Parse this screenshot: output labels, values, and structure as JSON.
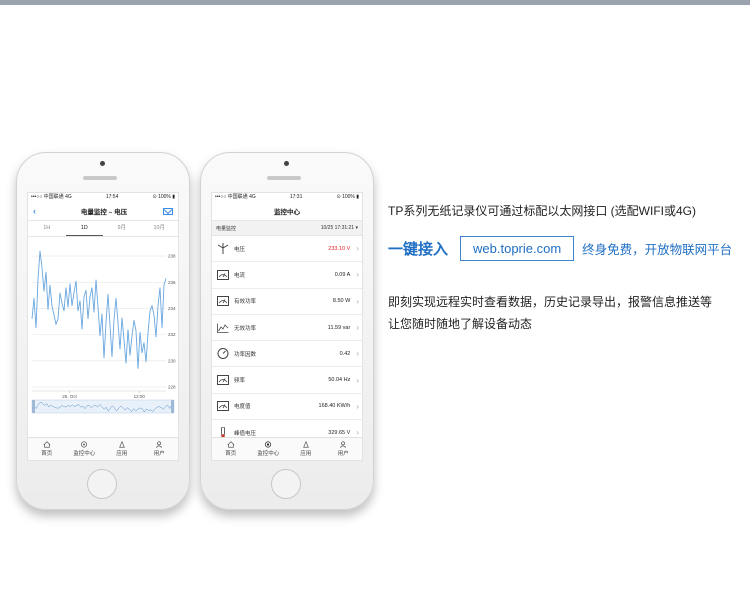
{
  "phone1": {
    "status": {
      "carrier": "•••○○ 中国联通  4G",
      "time": "17:54",
      "battery": "⊙ 100% ▮"
    },
    "nav_title": "电量监控 – 电压",
    "tabs": [
      {
        "label": "1H"
      },
      {
        "label": "1D"
      },
      {
        "label": "9月"
      },
      {
        "label": "10月"
      }
    ],
    "active_tab": "1D"
  },
  "chart_data": {
    "type": "line",
    "title": "",
    "xlabel": "",
    "ylabel": "",
    "y_ticks": [
      "238",
      "236",
      "234",
      "232",
      "230",
      "228"
    ],
    "ylim": [
      228,
      239
    ],
    "x_ticks": [
      "25. Oct",
      "12:00"
    ],
    "color": "#6aa7e0",
    "series": [
      {
        "values": [
          233.2,
          234.8,
          232.5,
          236.2,
          238.4,
          237.1,
          235.3,
          236.8,
          233.9,
          235.8,
          234.2,
          233.5,
          232.8,
          233.2,
          235.2,
          234.4,
          233.8,
          235.6,
          234.1,
          235.9,
          234.2,
          235.2,
          236.1,
          233.8,
          234.6,
          232.4,
          234.9,
          235.4,
          233.2,
          234.9,
          235.6,
          233.7,
          236.2,
          234.1,
          231.9,
          233.6,
          230.2,
          232.9,
          235.1,
          232.7,
          230.3,
          233.1,
          234.8,
          232.9,
          230.9,
          233.3,
          231.6,
          229.8,
          232.4,
          230.4,
          231.9,
          233.1,
          232.3,
          229.4,
          232.2,
          230.6,
          231.4,
          229.9,
          232.1,
          233.8,
          234.2,
          233.5,
          231.8,
          234.2,
          235.6,
          232.5,
          235.8,
          236.3
        ]
      }
    ]
  },
  "phone1_tabbar": [
    {
      "label": "首页"
    },
    {
      "label": "监控中心"
    },
    {
      "label": "应用"
    },
    {
      "label": "用户"
    }
  ],
  "phone2": {
    "status": {
      "carrier": "•••○○ 中国联通  4G",
      "time": "17:31",
      "battery": "⊙ 100% ▮"
    },
    "nav_title": "监控中心",
    "section": {
      "label": "电量监控",
      "time": "10/25 17:31:21"
    },
    "rows": [
      {
        "label": "电压",
        "value": "233.10  V",
        "icon": "wind-turbine-icon",
        "alarm": true
      },
      {
        "label": "电流",
        "value": "0.09  A",
        "icon": "meter-icon",
        "alarm": false
      },
      {
        "label": "有效功率",
        "value": "8.50  W",
        "icon": "meter-icon",
        "alarm": false
      },
      {
        "label": "无效功率",
        "value": "11.59  var",
        "icon": "trend-icon",
        "alarm": false
      },
      {
        "label": "功率因数",
        "value": "0.42",
        "icon": "gauge-icon",
        "alarm": false
      },
      {
        "label": "频率",
        "value": "50.04  Hz",
        "icon": "meter-icon",
        "alarm": false
      },
      {
        "label": "电度值",
        "value": "168.40  KW/h",
        "icon": "meter-icon",
        "alarm": false
      },
      {
        "label": "峰值电压",
        "value": "329.65  V",
        "icon": "thermometer-icon",
        "alarm": false
      }
    ],
    "tabbar": [
      {
        "label": "首页"
      },
      {
        "label": "监控中心"
      },
      {
        "label": "应用"
      },
      {
        "label": "用户"
      }
    ]
  },
  "promo": {
    "intro": "TP系列无纸记录仪可通过标配以太网接口 (选配WIFI或4G)",
    "access_label": "一键接入",
    "url": "web.toprie.com",
    "free_text": "终身免费，开放物联网平台",
    "desc_line1": "即刻实现远程实时查看数据，历史记录导出，报警信息推送等",
    "desc_line2": "让您随时随地了解设备动态"
  },
  "colors": {
    "accent": "#1f6fc4",
    "alarm": "#e02020",
    "line": "#6aa7e0"
  }
}
